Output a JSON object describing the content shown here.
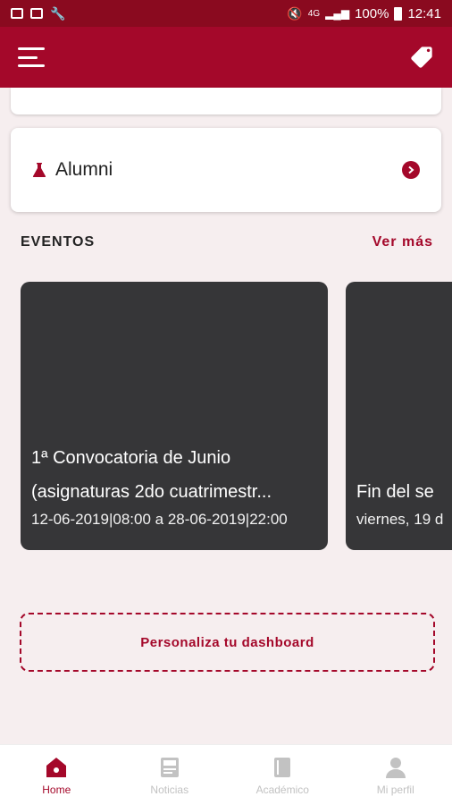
{
  "status_bar": {
    "battery": "100%",
    "time": "12:41",
    "network": "4G"
  },
  "app_bar": {
    "menu_icon": "hamburger-icon",
    "action_icon": "tag-icon"
  },
  "alumni_card": {
    "label": "Alumni",
    "icon": "flask-icon"
  },
  "events": {
    "title": "EVENTOS",
    "see_more": "Ver más",
    "items": [
      {
        "title_line1": "1ª Convocatoria de Junio",
        "title_line2": "(asignaturas 2do cuatrimestr...",
        "date": "12-06-2019|08:00 a 28-06-2019|22:00"
      },
      {
        "title_line1": "Fin del se",
        "date": "viernes, 19 d"
      }
    ]
  },
  "personaliza_button": "Personaliza tu dashboard",
  "bottom_nav": {
    "items": [
      {
        "label": "Home",
        "icon": "home-icon",
        "active": true
      },
      {
        "label": "Noticias",
        "icon": "news-icon",
        "active": false
      },
      {
        "label": "Académico",
        "icon": "book-icon",
        "active": false
      },
      {
        "label": "Mi perfil",
        "icon": "profile-icon",
        "active": false
      }
    ]
  },
  "colors": {
    "brand": "#a4082a",
    "status_bar": "#8a0a1f",
    "background": "#f6eeef",
    "event_card": "#363638",
    "inactive": "#c2c2c2"
  }
}
